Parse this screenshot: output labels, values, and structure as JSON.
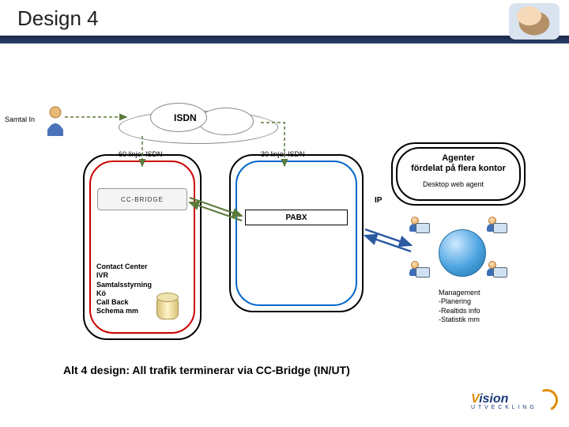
{
  "header": {
    "title": "Design 4"
  },
  "labels": {
    "samtal_in": "Samtal In",
    "isdn": "ISDN",
    "lines60": "60 linjer ISDN",
    "lines30": "30 linjer ISDN",
    "pabx": "PABX",
    "ip": "IP",
    "desktop_web_agent": "Desktop web agent"
  },
  "agents_box": {
    "line1": "Agenter",
    "line2": "fördelat på flera kontor"
  },
  "cc_bridge": {
    "brand": "CC-BRIDGE"
  },
  "contact_center": {
    "items": [
      "Contact Center",
      "IVR",
      "Samtalsstyrning",
      "Kö",
      "Call Back",
      "Schema mm"
    ]
  },
  "management": {
    "title": "Management",
    "items": [
      "-Planering",
      "-Realtids info",
      "-Statistik mm"
    ]
  },
  "caption": "Alt 4 design: All trafik terminerar via CC-Bridge (IN/UT)",
  "logo": {
    "brand_v": "V",
    "brand_rest": "ision",
    "sub": "U T V E C K L I N G"
  }
}
